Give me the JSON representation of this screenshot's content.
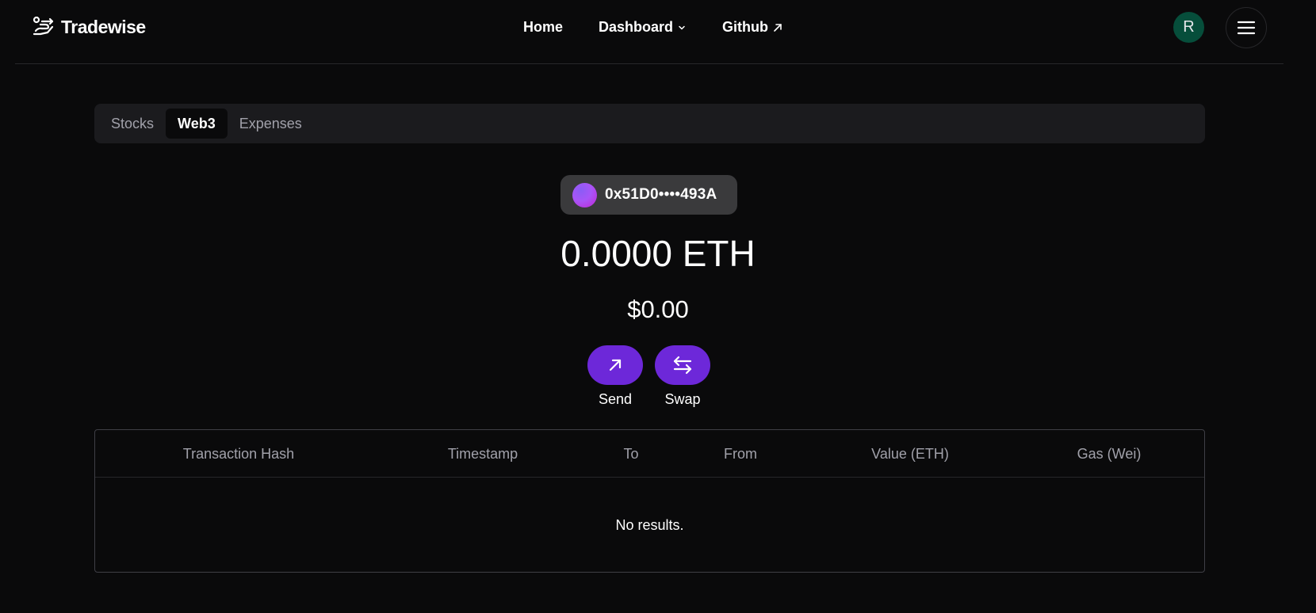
{
  "header": {
    "brand_name": "Tradewise",
    "brand_icon": "handshake-arrows-icon",
    "nav": {
      "home": "Home",
      "dashboard": "Dashboard",
      "github": "Github"
    },
    "avatar_initial": "R",
    "menu_icon": "hamburger-menu-icon"
  },
  "tabs": [
    {
      "label": "Stocks",
      "active": false
    },
    {
      "label": "Web3",
      "active": true
    },
    {
      "label": "Expenses",
      "active": false
    }
  ],
  "wallet": {
    "address": "0x51D0••••493A",
    "balance_eth": "0.0000 ETH",
    "balance_usd": "$0.00"
  },
  "actions": {
    "send_label": "Send",
    "swap_label": "Swap"
  },
  "table": {
    "columns": [
      "Transaction Hash",
      "Timestamp",
      "To",
      "From",
      "Value (ETH)",
      "Gas (Wei)"
    ],
    "empty_text": "No results."
  },
  "colors": {
    "background": "#0a0a0b",
    "accent": "#6d28d9",
    "avatar_bg": "#064e3b"
  }
}
